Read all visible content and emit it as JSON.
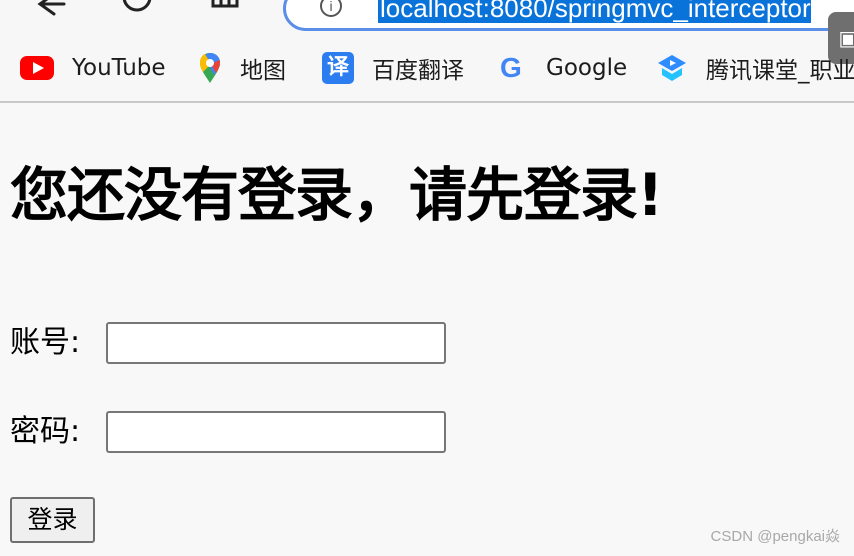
{
  "browser": {
    "url": "localhost:8080/springmvc_interceptor",
    "icons": {
      "back": "arrow-left-icon",
      "refresh": "circle-refresh-icon",
      "home": "home-icon",
      "info": "info-icon",
      "side_tab": "square-icon"
    },
    "accent_color": "#0a73d9"
  },
  "bookmarks": [
    {
      "label": "YouTube",
      "icon": "youtube-icon",
      "color": "#ff0000"
    },
    {
      "label": "地图",
      "icon": "map-pin-icon",
      "color": "#34a853"
    },
    {
      "label": "百度翻译",
      "icon": "translate-icon",
      "color": "#2b7df0"
    },
    {
      "label": "Google",
      "icon": "google-icon",
      "color": "#4285f4"
    },
    {
      "label": "腾讯课堂_职业",
      "icon": "tencent-classroom-icon",
      "color": "#24a0ff"
    }
  ],
  "page": {
    "title": "您还没有登录，请先登录!",
    "account_label": "账号:",
    "account_value": "",
    "password_label": "密码:",
    "password_value": "",
    "login_button": "登录"
  },
  "watermark": "CSDN @pengkai焱"
}
